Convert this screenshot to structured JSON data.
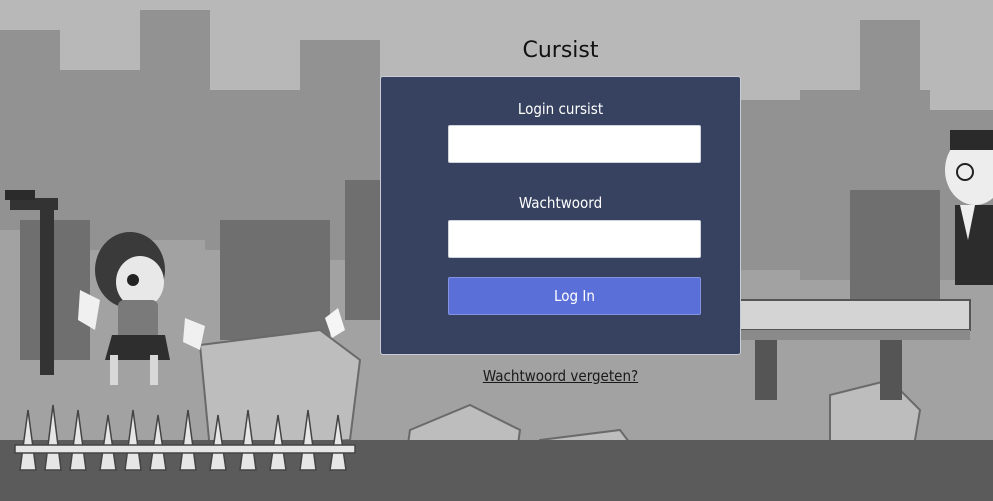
{
  "header": {
    "title": "Cursist"
  },
  "login_form": {
    "username_label": "Login cursist",
    "username_value": "",
    "password_label": "Wachtwoord",
    "password_value": "",
    "submit_label": "Log In"
  },
  "forgot_password": {
    "label": "Wachtwoord vergeten?"
  },
  "colors": {
    "card_background": "#36425f",
    "button_background": "#5b6fd9"
  }
}
